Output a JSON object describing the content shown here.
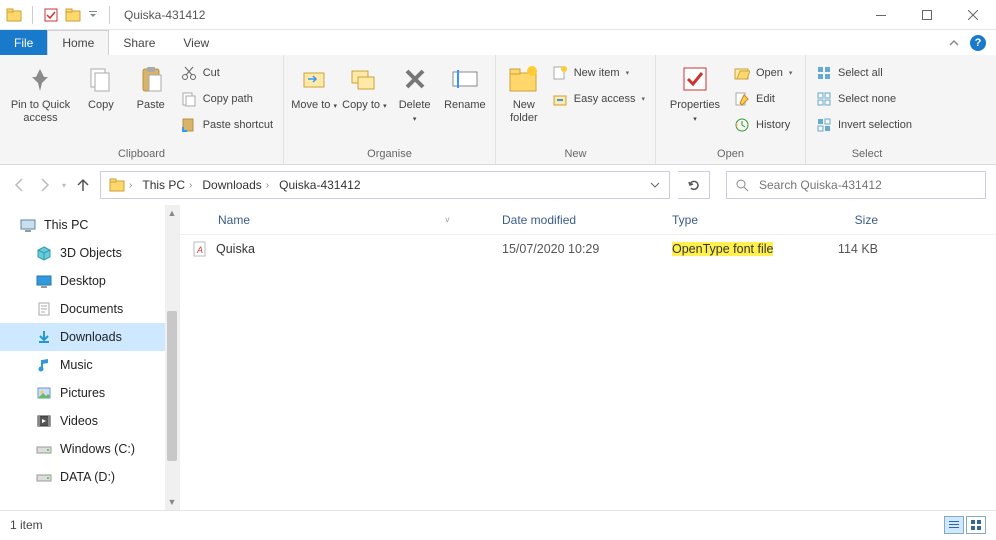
{
  "window": {
    "title": "Quiska-431412"
  },
  "tabs": {
    "file": "File",
    "home": "Home",
    "share": "Share",
    "view": "View"
  },
  "ribbon": {
    "clipboard": {
      "label": "Clipboard",
      "pin": "Pin to Quick access",
      "copy": "Copy",
      "paste": "Paste",
      "cut": "Cut",
      "copypath": "Copy path",
      "pasteshortcut": "Paste shortcut"
    },
    "organise": {
      "label": "Organise",
      "moveto": "Move to",
      "copyto": "Copy to",
      "delete": "Delete",
      "rename": "Rename"
    },
    "new": {
      "label": "New",
      "newfolder": "New folder",
      "newitem": "New item",
      "easyaccess": "Easy access"
    },
    "open": {
      "label": "Open",
      "properties": "Properties",
      "open": "Open",
      "edit": "Edit",
      "history": "History"
    },
    "select": {
      "label": "Select",
      "selectall": "Select all",
      "selectnone": "Select none",
      "invert": "Invert selection"
    }
  },
  "breadcrumbs": [
    "This PC",
    "Downloads",
    "Quiska-431412"
  ],
  "search_placeholder": "Search Quiska-431412",
  "tree": {
    "thispc": "This PC",
    "objects3d": "3D Objects",
    "desktop": "Desktop",
    "documents": "Documents",
    "downloads": "Downloads",
    "music": "Music",
    "pictures": "Pictures",
    "videos": "Videos",
    "windowsc": "Windows (C:)",
    "datad": "DATA (D:)"
  },
  "columns": {
    "name": "Name",
    "date": "Date modified",
    "type": "Type",
    "size": "Size"
  },
  "files": [
    {
      "name": "Quiska",
      "date": "15/07/2020 10:29",
      "type": "OpenType font file",
      "size": "114 KB",
      "highlighted_type": true
    }
  ],
  "status": {
    "count": "1 item"
  }
}
